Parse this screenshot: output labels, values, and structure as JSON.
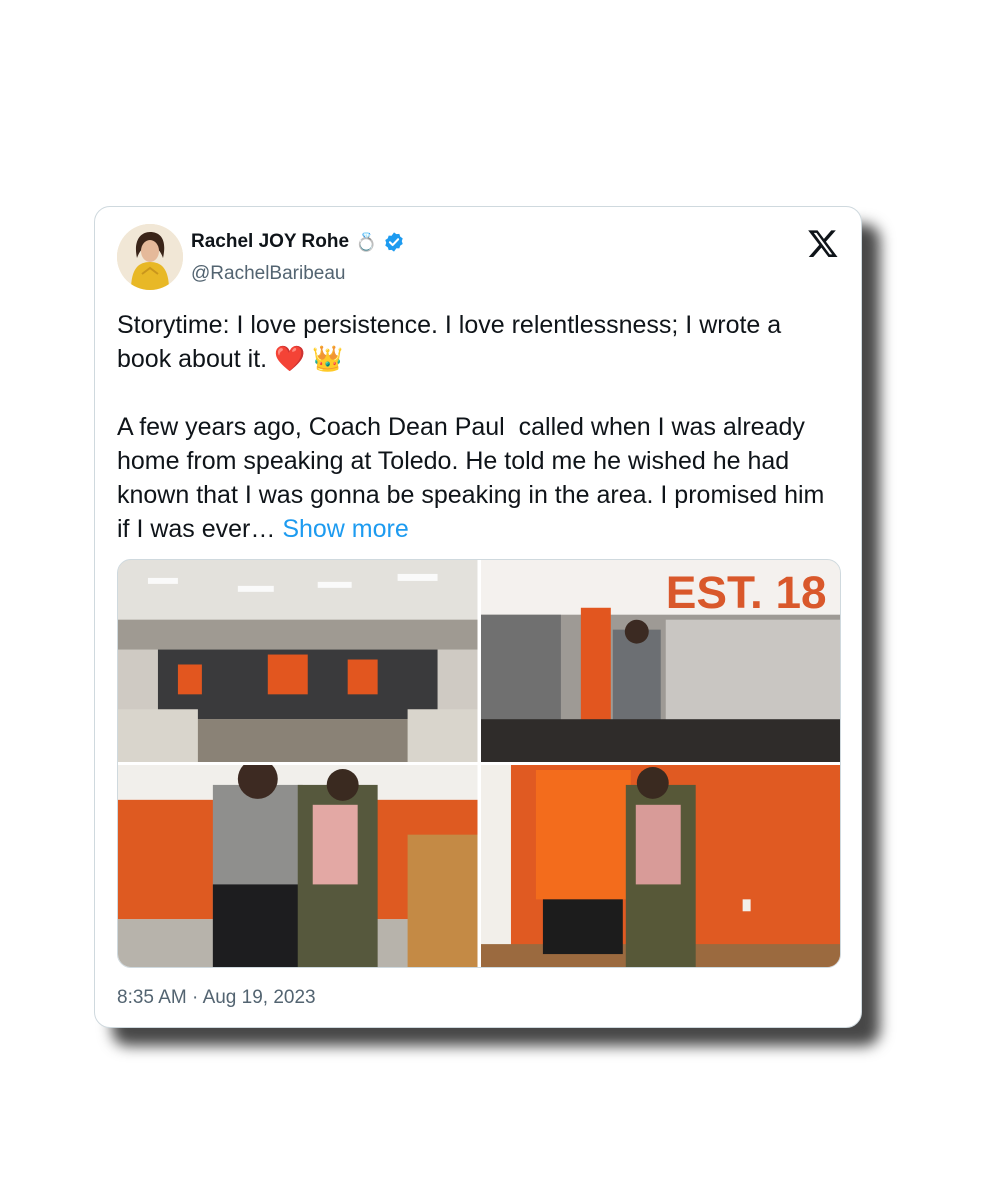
{
  "tweet": {
    "display_name": "Rachel JOY Rohe",
    "name_emoji": "💍",
    "handle": "@RachelBaribeau",
    "text": "Storytime: I love persistence. I love relentlessness; I wrote a book about it. ❤️ 👑\n\nA few years ago, Coach Dean Paul  called when I was already home from speaking at Toledo. He told me he wished he had known that I was gonna be speaking in the area. I promised him if I was ever… ",
    "show_more": "Show more",
    "time": "8:35 AM",
    "separator": "·",
    "date": "Aug 19, 2023",
    "photo_sign_text": "EST. 18"
  },
  "icons": {
    "verified": "verified-badge-icon",
    "x_logo": "x-logo-icon"
  },
  "colors": {
    "link": "#1d9bf0",
    "verified": "#1d9bf0",
    "accent_orange": "#e2561f"
  }
}
